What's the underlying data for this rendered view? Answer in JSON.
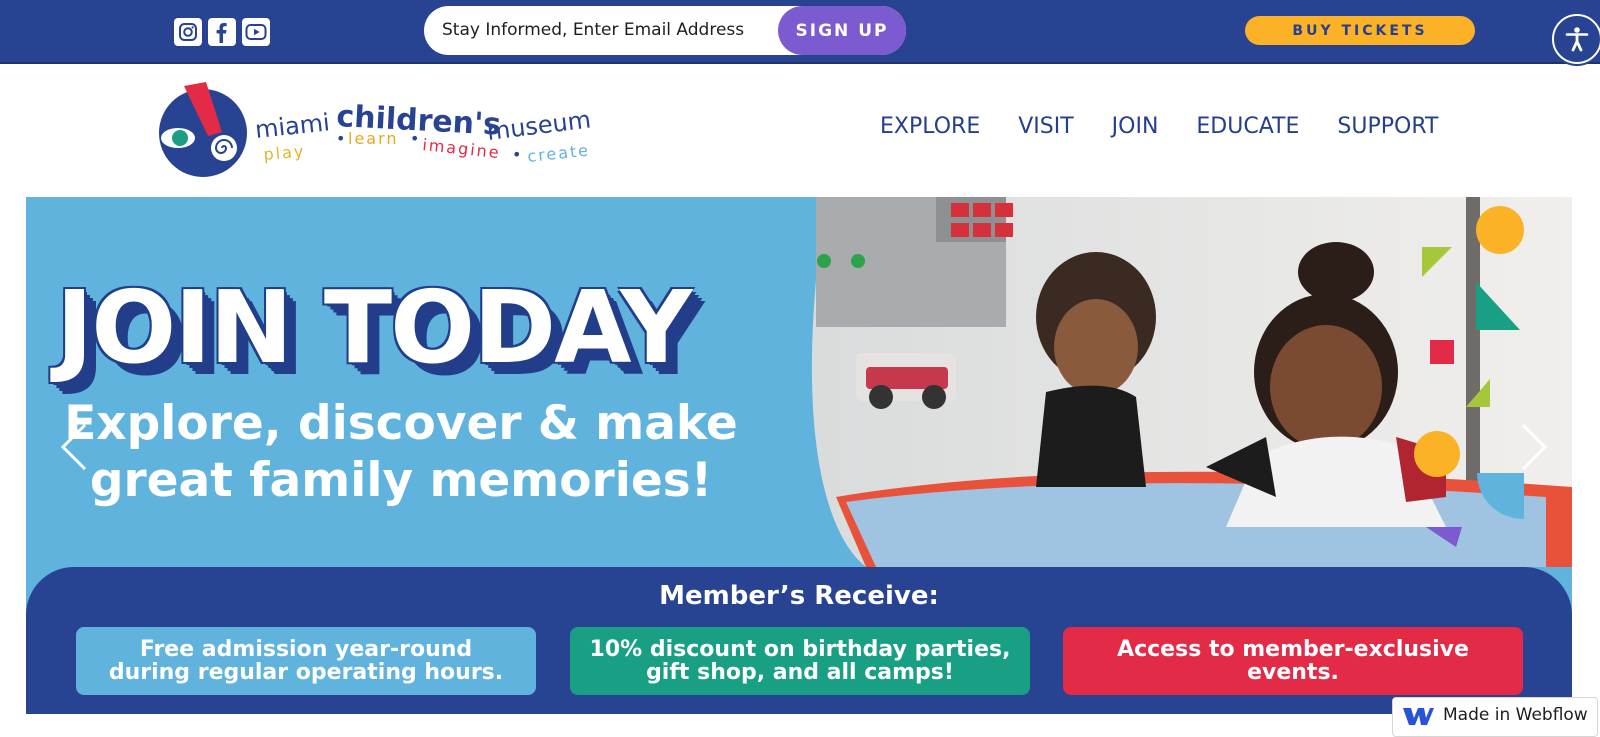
{
  "topbar": {
    "social": [
      {
        "icon": "instagram-icon"
      },
      {
        "icon": "facebook-icon"
      },
      {
        "icon": "youtube-icon"
      }
    ],
    "signup": {
      "placeholder": "Stay Informed, Enter Email Address",
      "button_label": "SIGN UP"
    },
    "buy_tickets_label": "BUY TICKETS",
    "accessibility_icon": "accessibility-icon"
  },
  "logo": {
    "line1": "miami",
    "line1b": "children's",
    "line1c": "museum",
    "tagline": [
      "play",
      "learn",
      "imagine",
      "create"
    ]
  },
  "nav": {
    "items": [
      "EXPLORE",
      "VISIT",
      "JOIN",
      "EDUCATE",
      "SUPPORT"
    ]
  },
  "hero": {
    "headline": "JOIN TODAY",
    "subheadline_line1": "Explore, discover & make",
    "subheadline_line2": "great family memories!",
    "members_title": "Member’s Receive:",
    "benefits": [
      {
        "line1": "Free admission year-round",
        "line2": "during regular operating hours."
      },
      {
        "line1": "10% discount on birthday parties,",
        "line2": "gift shop, and all camps!"
      },
      {
        "line1": "Access to member-exclusive events.",
        "line2": ""
      }
    ]
  },
  "badge": {
    "label": "Made in Webflow"
  },
  "colors": {
    "navy": "#284391",
    "sky": "#5fb3dc",
    "purple": "#7b5bcf",
    "yellow": "#fbb227",
    "green": "#189f84",
    "red": "#e32a46"
  }
}
